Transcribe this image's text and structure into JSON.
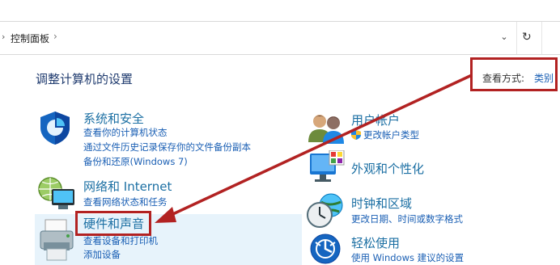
{
  "address": {
    "breadcrumb": "控制面板",
    "separator": "›",
    "dropdown_glyph": "⌄",
    "refresh_glyph": "↻"
  },
  "title": "调整计算机的设置",
  "view_by": {
    "label": "查看方式:",
    "value": "类别"
  },
  "left_categories": [
    {
      "title": "系统和安全",
      "icon": "shield-icon",
      "links": [
        "查看你的计算机状态",
        "通过文件历史记录保存你的文件备份副本",
        "备份和还原(Windows 7)"
      ]
    },
    {
      "title": "网络和 Internet",
      "icon": "network-globe-icon",
      "links": [
        "查看网络状态和任务"
      ]
    },
    {
      "title": "硬件和声音",
      "icon": "printer-icon",
      "links": [
        "查看设备和打印机",
        "添加设备"
      ]
    }
  ],
  "right_categories": [
    {
      "title": "用户帐户",
      "icon": "users-icon",
      "links": [
        "更改帐户类型"
      ]
    },
    {
      "title": "外观和个性化",
      "icon": "monitor-palette-icon",
      "links": []
    },
    {
      "title": "时钟和区域",
      "icon": "clock-globe-icon",
      "links": [
        "更改日期、时间或数字格式"
      ]
    },
    {
      "title": "轻松使用",
      "icon": "ease-of-access-icon",
      "links": [
        "使用 Windows 建议的设置"
      ]
    }
  ],
  "colors": {
    "highlight": "#b22222",
    "link": "#1a5fb4",
    "category_title": "#1b6fa3",
    "hover_bg": "#e7f3fb"
  }
}
